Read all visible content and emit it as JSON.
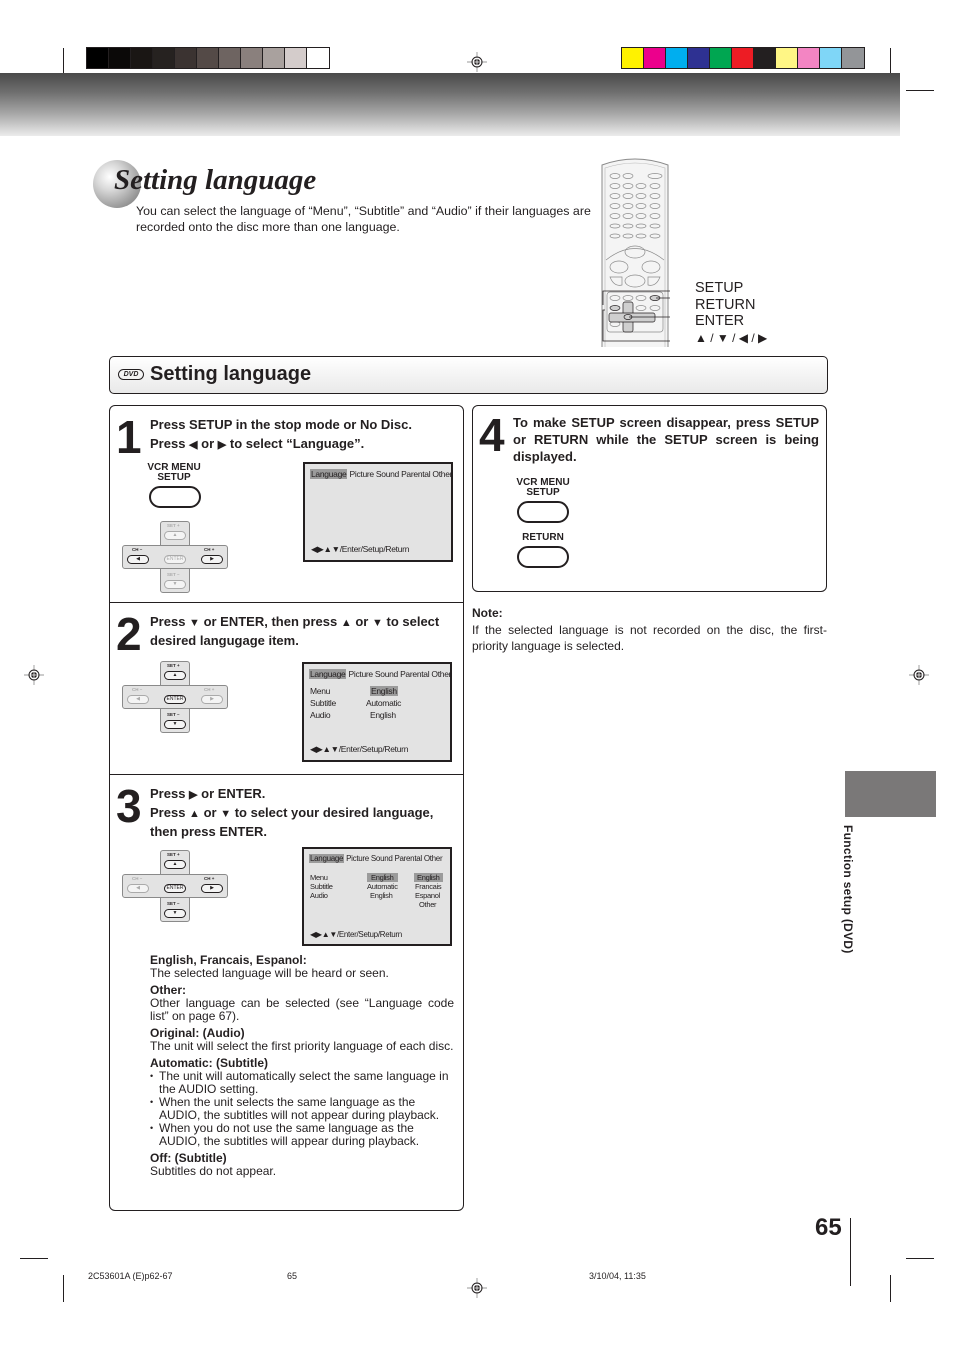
{
  "print_marks": {
    "gray_swatches": [
      "#000000",
      "#0b0908",
      "#1a1614",
      "#262220",
      "#3b3331",
      "#544a47",
      "#6e6461",
      "#8a807d",
      "#a9a19e",
      "#d4cccb",
      "#ffffff"
    ],
    "color_swatches": [
      "#fff200",
      "#ec008c",
      "#00aeef",
      "#2e3192",
      "#00a651",
      "#ed1c24",
      "#231f20",
      "#fff685",
      "#f385c3",
      "#7fd6f7",
      "#939598"
    ]
  },
  "header": {
    "title": "Setting language",
    "intro": "You can select the language of “Menu”, “Subtitle” and “Audio” if their languages are recorded onto the disc more than one language."
  },
  "remote": {
    "labels": [
      "SETUP",
      "RETURN",
      "ENTER",
      "▲ / ▼ / ◀ / ▶"
    ]
  },
  "section": {
    "badge": "DVD",
    "title": "Setting language"
  },
  "steps": [
    {
      "number": "1",
      "line1": "Press SETUP in the stop mode or No Disc.",
      "line2_a": "Press",
      "line2_b": "or",
      "line2_c": "to select “Language”.",
      "button_label_1": "VCR MENU",
      "button_label_2": "SETUP"
    },
    {
      "number": "2",
      "line1_a": "Press",
      "line1_b": "or ENTER, then press",
      "line1_c": "or",
      "line1_d": "to select",
      "line2": "desired langugage item."
    },
    {
      "number": "3",
      "line1_a": "Press",
      "line1_b": "or ENTER.",
      "line2_a": "Press",
      "line2_b": "or",
      "line2_c": "to select your desired language,",
      "line3": "then press ENTER."
    },
    {
      "number": "4",
      "text": "To make SETUP screen disappear, press SETUP or RETURN while the SETUP screen is being displayed.",
      "button_label_1": "VCR MENU",
      "button_label_2": "SETUP",
      "button_label_3": "RETURN"
    }
  ],
  "dpad": {
    "set_plus": "SET +",
    "set_minus": "SET –",
    "ch_minus": "CH –",
    "ch_plus": "CH +",
    "enter": "ENTER",
    "up": "▲",
    "down": "▼",
    "left": "◀",
    "right": "▶"
  },
  "osd": {
    "tabs": [
      "Language",
      "Picture",
      "Sound",
      "Parental",
      "Other"
    ],
    "nav_hint": "◀▶▲▼/Enter/Setup/Return",
    "rows": [
      "Menu",
      "Subtitle",
      "Audio"
    ],
    "values": [
      "English",
      "Automatic",
      "English"
    ],
    "options": [
      "English",
      "Francais",
      "Espanol",
      "Other"
    ]
  },
  "definitions": [
    {
      "term": "English, Francais, Espanol:",
      "desc": "The selected language will be heard or seen."
    },
    {
      "term": "Other:",
      "desc": "Other language can be selected (see “Language code list” on page 67)."
    },
    {
      "term": "Original: (Audio)",
      "desc": "The unit will select the first priority language of each disc."
    },
    {
      "term": "Automatic: (Subtitle)",
      "bullets": [
        "The unit will automatically select the same language in the AUDIO setting.",
        "When the unit selects the same language as the AUDIO, the subtitles  will not appear during playback.",
        "When you do not use the same language as the AUDIO, the subtitles  will appear during playback."
      ]
    },
    {
      "term": "Off: (Subtitle)",
      "desc": "Subtitles do not appear."
    }
  ],
  "note": {
    "title": "Note:",
    "text": "If the selected language is not recorded on the disc, the first-priority language is selected."
  },
  "side_tab": {
    "label": "Function setup  (DVD)"
  },
  "page_number": "65",
  "footer": {
    "doc_code": "2C53601A (E)p62-67",
    "page": "65",
    "timestamp": "3/10/04, 11:35"
  }
}
